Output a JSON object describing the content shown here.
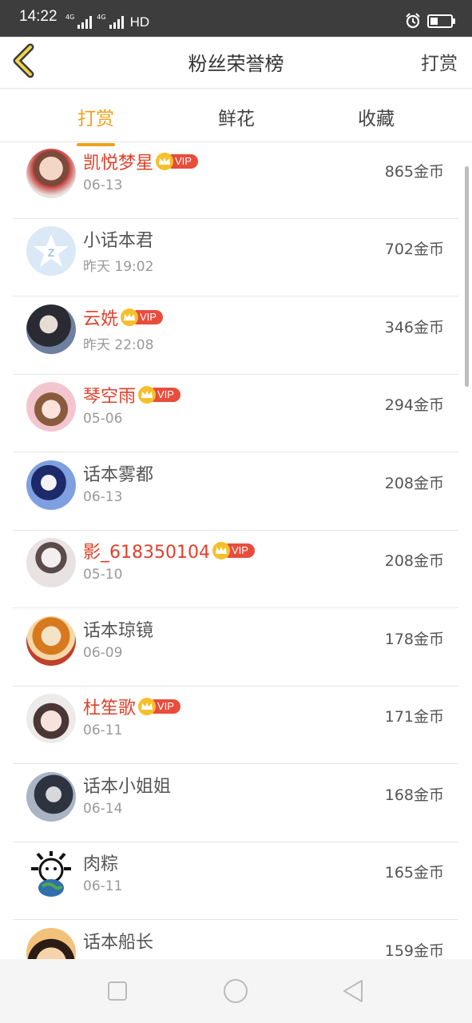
{
  "status_bar": {
    "time": "14:22",
    "net1": "4G",
    "net2": "4G",
    "hd": "HD"
  },
  "header": {
    "title": "粉丝荣誉榜",
    "action": "打赏"
  },
  "tabs": [
    {
      "label": "打赏",
      "active": true
    },
    {
      "label": "鲜花",
      "active": false
    },
    {
      "label": "收藏",
      "active": false
    }
  ],
  "fans": [
    {
      "name": "凯悦梦星",
      "vip": true,
      "vip_label": "VIP",
      "date": "06-13",
      "amount": "865金币"
    },
    {
      "name": "小话本君",
      "vip": false,
      "date": "昨天 19:02",
      "amount": "702金币"
    },
    {
      "name": "云姺",
      "vip": true,
      "vip_label": "VIP",
      "date": "昨天 22:08",
      "amount": "346金币"
    },
    {
      "name": "琴空雨",
      "vip": true,
      "vip_label": "VIP",
      "date": "05-06",
      "amount": "294金币"
    },
    {
      "name": "话本雾都",
      "vip": false,
      "date": "06-13",
      "amount": "208金币"
    },
    {
      "name": "影_618350104",
      "vip": true,
      "vip_label": "VIP",
      "date": "05-10",
      "amount": "208金币"
    },
    {
      "name": "话本琼镜",
      "vip": false,
      "date": "06-09",
      "amount": "178金币"
    },
    {
      "name": "杜笙歌",
      "vip": true,
      "vip_label": "VIP",
      "date": "06-11",
      "amount": "171金币"
    },
    {
      "name": "话本小姐姐",
      "vip": false,
      "date": "06-14",
      "amount": "168金币"
    },
    {
      "name": "肉粽",
      "vip": false,
      "date": "06-11",
      "amount": "165金币"
    },
    {
      "name": "话本船长",
      "vip": false,
      "date": "",
      "amount": "159金币"
    }
  ],
  "colors": {
    "accent": "#f0a21c",
    "vip_name": "#e0402a",
    "vip_badge": "#e84d3c"
  },
  "icons": {
    "back": "chevron-left-icon",
    "crown": "crown-icon",
    "nav": [
      "square-icon",
      "circle-icon",
      "triangle-back-icon"
    ]
  }
}
